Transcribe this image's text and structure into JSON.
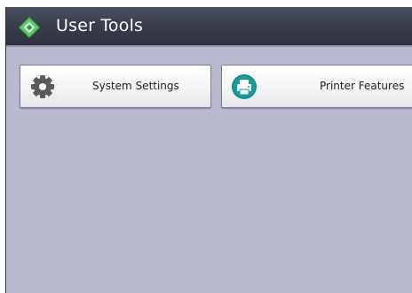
{
  "header": {
    "title": "User Tools",
    "icon": "user-tools-icon"
  },
  "tiles": [
    {
      "label": "System Settings",
      "icon": "gear-icon"
    },
    {
      "label": "Printer Features",
      "icon": "printer-icon"
    }
  ],
  "colors": {
    "titlebar": "#3a3e4b",
    "background": "#b9bad2",
    "printer_icon": "#0f8a8a",
    "gear_icon": "#5b5b5b",
    "logo_green": "#3fb34f"
  }
}
